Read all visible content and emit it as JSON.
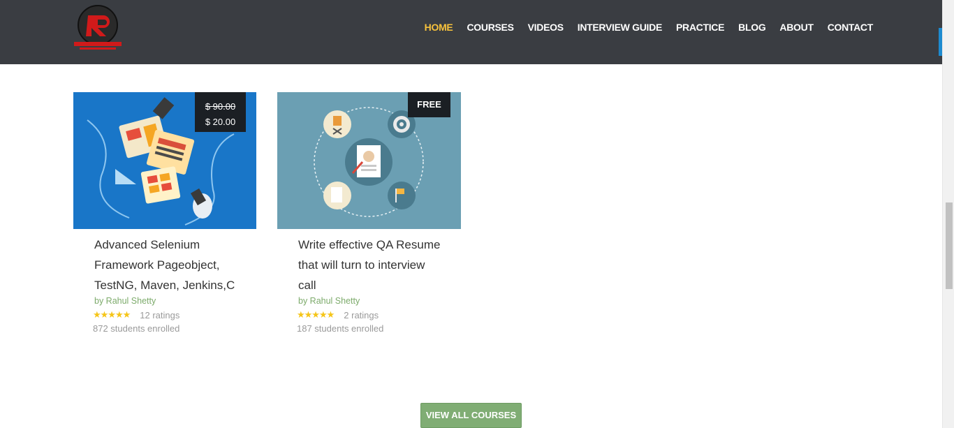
{
  "header": {
    "nav": [
      "HOME",
      "COURSES",
      "VIDEOS",
      "INTERVIEW GUIDE",
      "PRACTICE",
      "BLOG",
      "ABOUT",
      "CONTACT"
    ],
    "active": "HOME",
    "accent_color": "#f7c23c",
    "bg_color": "#3a3d42"
  },
  "courses": [
    {
      "title": "Advanced Selenium Framework Pageobject, TestNG, Maven, Jenkins,C",
      "author": "by Rahul Shetty",
      "stars": "★★★★★",
      "ratings": "12 ratings",
      "enrolled": "872 students enrolled",
      "price_old": "$ 90.00",
      "price_new": "$ 20.00",
      "image_icon": "selenium-framework-illustration"
    },
    {
      "title": "Write effective QA Resume that will turn to interview call",
      "author": "by Rahul Shetty",
      "stars": "★★★★★",
      "ratings": "2 ratings",
      "enrolled": "187 students enrolled",
      "price_label": "FREE",
      "image_icon": "resume-illustration"
    }
  ],
  "view_all_label": "VIEW ALL COURSES"
}
